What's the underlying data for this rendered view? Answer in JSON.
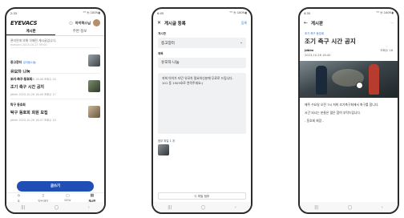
{
  "screen1": {
    "status_time": "2:33",
    "status_right": "⁵ᴳ ⓦ 100%▮",
    "logo": "EYEVACS",
    "user_name": "아이락스님",
    "tabs": [
      "게시판",
      "주변 정보"
    ],
    "notice": {
      "text": "관리인에 의해 삭제된 게시글입니다.",
      "meta": "eyevacs 2023-10-27 09:00"
    },
    "posts": [
      {
        "board": "중고장터",
        "tag": "유아동/나눔",
        "title": "유모차 나눔",
        "meta": "jdkim 2023-10-26 18:46 조회수 24"
      },
      {
        "board": "조기 축구 동호회",
        "tag": "",
        "title": "조기 축구 시간 공지",
        "meta": "jdkim 2023-10-26 18:40 조회수 17"
      },
      {
        "board": "탁구 동호회",
        "tag": "",
        "title": "탁구 동호회 회원 모집",
        "meta": "jdkim 2023-10-26 18:37 조회수 10"
      }
    ],
    "write_button": "글쓰기",
    "bottom_nav": [
      {
        "icon": "⌂",
        "label": "홈"
      },
      {
        "icon": "▯",
        "label": "방문/예약"
      },
      {
        "icon": "▢",
        "label": "VIEW"
      },
      {
        "icon": "▤",
        "label": "게시판"
      }
    ]
  },
  "screen2": {
    "status_time": "6:45",
    "status_right": "⁵ᴳ ⓦ 100%▮",
    "title": "게시글 등록",
    "register": "등록",
    "board_label": "게시판",
    "board_value": "중고장터",
    "title_label": "제목",
    "title_value": "유모차 나눔",
    "content": "저희 아이가 타던 유모차 필요하신분께 무료로 드립니다.\n101 동 1503호로 연락주세요:)",
    "attach_label": "첨부 파일 1 개",
    "attach_button": "파일 첨부"
  },
  "screen3": {
    "status_time": "4:35",
    "status_right": "⁵ᴳ ⓦ 100%▮",
    "back_title": "게시판",
    "board": "조기 축구 동호회",
    "title": "조기 축구 시간 공지",
    "author": "jdkim",
    "views": "조회수 18",
    "date": "2023-10-26 18:40",
    "body": [
      "매주 수요일 오전 7시 저희 조기축구회에서 축구를 합니다.",
      "시간 되시는 분들은 많은 참여 부탁드립니다.",
      "- 동호회 회장 -"
    ]
  },
  "sysnav": [
    "|||",
    "◯",
    "‹"
  ]
}
